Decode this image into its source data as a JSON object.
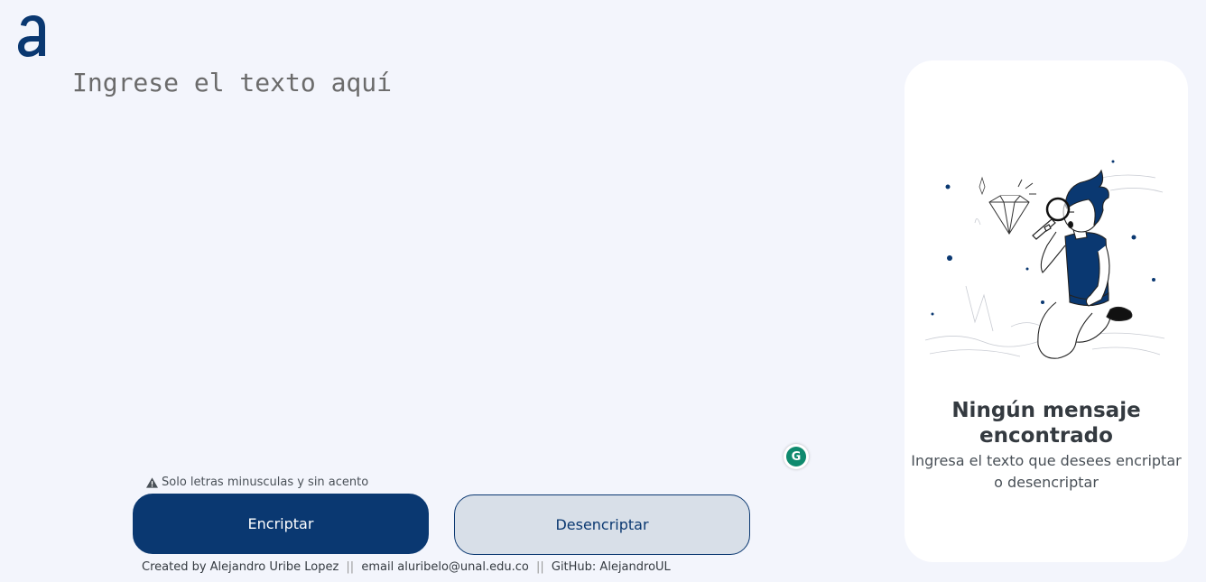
{
  "input": {
    "placeholder": "Ingrese el texto aquí"
  },
  "warning": {
    "text": "Solo letras minusculas y sin acento"
  },
  "buttons": {
    "encrypt": "Encriptar",
    "decrypt": "Desencriptar"
  },
  "footer": {
    "author": "Created by Alejandro Uribe Lopez",
    "separator": "||",
    "email": "email aluribelo@unal.edu.co",
    "github": "GitHub: AlejandroUL"
  },
  "panel": {
    "title": "Ningún mensaje encontrado",
    "subtitle": "Ingresa el texto que desees encriptar o desencriptar"
  },
  "colors": {
    "primary": "#0a3871",
    "background": "#f3f5fc",
    "panel": "#ffffff",
    "secondary_button": "#d8dfe8"
  },
  "icons": {
    "logo": "alura-logo-icon",
    "warning": "warning-triangle-icon",
    "grammarly": "grammarly-icon",
    "illustration": "person-magnifier-illustration"
  }
}
